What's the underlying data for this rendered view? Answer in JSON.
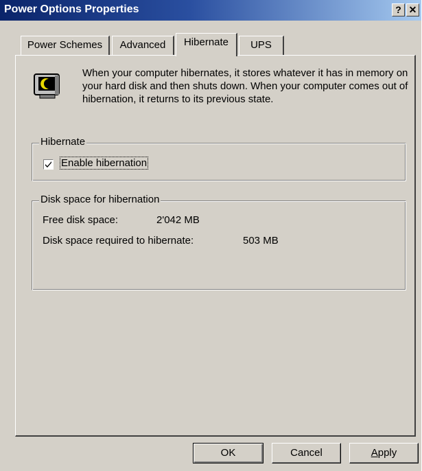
{
  "window": {
    "title": "Power Options Properties",
    "help_glyph": "?",
    "close_glyph": "✕"
  },
  "tabs": [
    {
      "label": "Power Schemes",
      "active": false
    },
    {
      "label": "Advanced",
      "active": false
    },
    {
      "label": "Hibernate",
      "active": true
    },
    {
      "label": "UPS",
      "active": false
    }
  ],
  "info": {
    "icon": "monitor-moon-icon",
    "text": "When your computer hibernates, it stores whatever it has in memory on your hard disk and then shuts down. When your computer comes out of hibernation, it returns to its previous state."
  },
  "hibernate_group": {
    "legend": "Hibernate",
    "checkbox_label": "Enable hibernation",
    "checked": true
  },
  "disk_group": {
    "legend": "Disk space for hibernation",
    "free_label": "Free disk space:",
    "free_value": "2'042 MB",
    "required_label": "Disk space required to hibernate:",
    "required_value": "503 MB"
  },
  "buttons": {
    "ok": "OK",
    "cancel": "Cancel",
    "apply": "Apply"
  }
}
